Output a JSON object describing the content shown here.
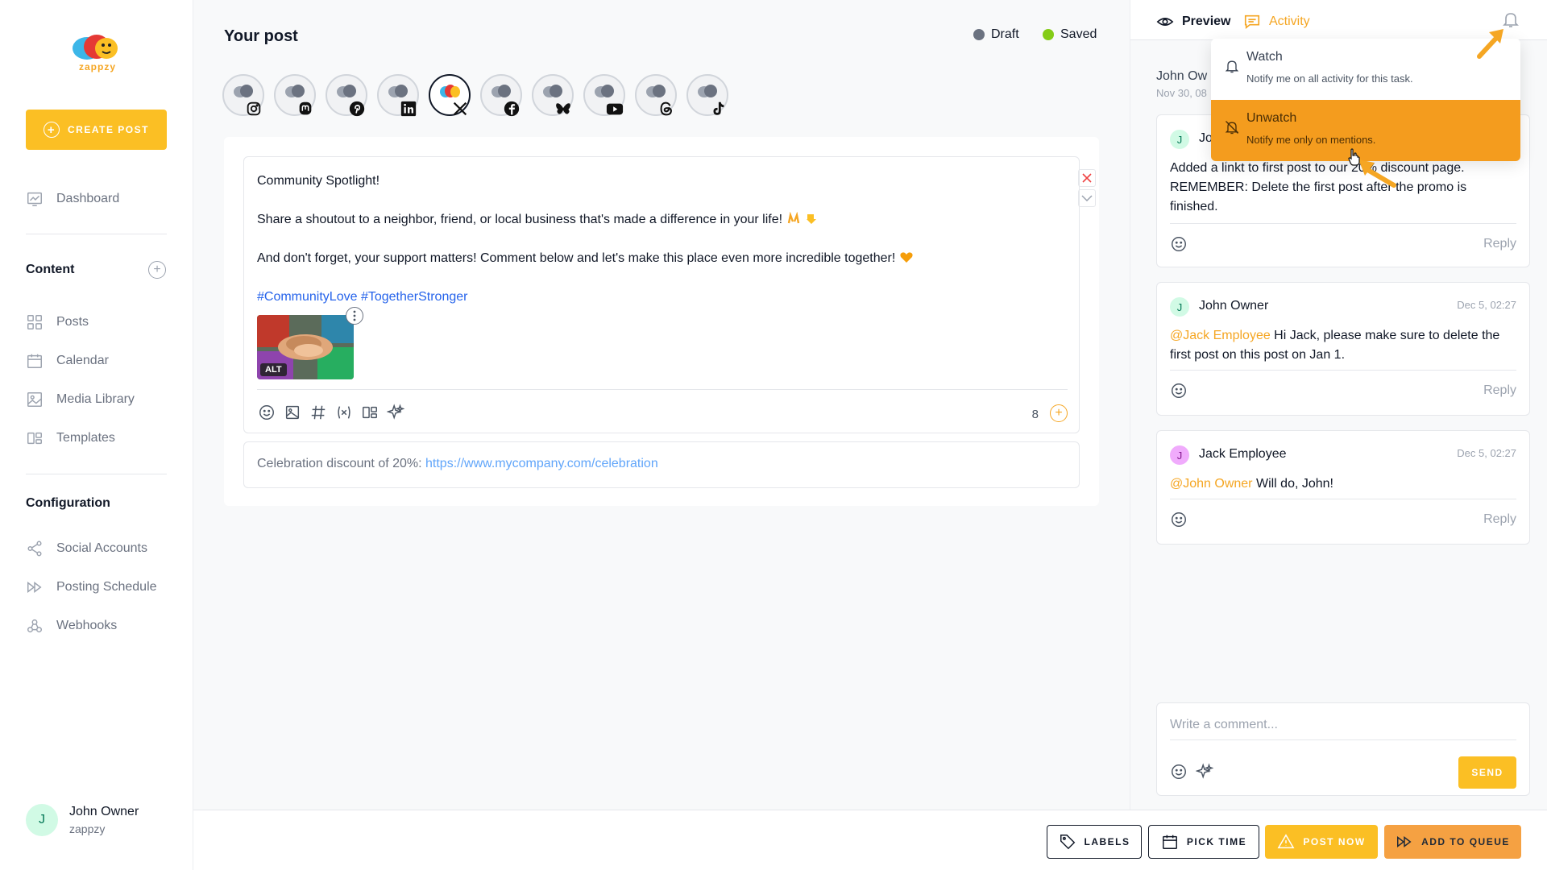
{
  "brand": {
    "name": "zappzy",
    "accent": "#fbbf24"
  },
  "sidebar": {
    "create_label": "CREATE POST",
    "dashboard": "Dashboard",
    "content_title": "Content",
    "content_items": [
      "Posts",
      "Calendar",
      "Media Library",
      "Templates"
    ],
    "config_title": "Configuration",
    "config_items": [
      "Social Accounts",
      "Posting Schedule",
      "Webhooks"
    ],
    "user": {
      "initial": "J",
      "name": "John Owner",
      "org": "zappzy"
    }
  },
  "editor": {
    "title": "Your post",
    "status_draft": "Draft",
    "status_saved": "Saved",
    "channels": [
      "instagram-icon",
      "mastodon-icon",
      "pinterest-icon",
      "linkedin-icon",
      "x-icon",
      "facebook-icon",
      "bluesky-icon",
      "youtube-icon",
      "threads-icon",
      "tiktok-icon"
    ],
    "active_channel": "x-icon",
    "post_lines": {
      "line1": "Community Spotlight!",
      "line2": "Share a shoutout to a neighbor, friend, or local business that's made a difference in your life!",
      "line3": "And don't forget, your support matters! Comment below and let's make this place even more incredible together!",
      "hashtags": "#CommunityLove #TogetherStronger"
    },
    "image_alt_tag": "ALT",
    "char_count": "8",
    "first_comment_prefix": "Celebration discount of 20%: ",
    "first_comment_link": "https://www.mycompany.com/celebration"
  },
  "panel": {
    "tab_preview": "Preview",
    "tab_activity": "Activity",
    "behind_author": "John Ow",
    "behind_date": "Nov 30, 08",
    "comments": [
      {
        "initial": "J",
        "author": "Jo",
        "date": "",
        "mention": "",
        "text": "Added a linkt to first post to our 20% discount page. REMEMBER: Delete the first post after the promo is finished."
      },
      {
        "initial": "J",
        "author": "John Owner",
        "date": "Dec 5, 02:27",
        "mention": "@Jack Employee",
        "text": " Hi Jack, please make sure to delete the first post on this post on Jan 1."
      },
      {
        "initial": "J",
        "author": "Jack Employee",
        "date": "Dec 5, 02:27",
        "mention": "@John Owner",
        "text": " Will do, John!"
      }
    ],
    "reply_label": "Reply",
    "comment_placeholder": "Write a comment...",
    "send_label": "SEND"
  },
  "dropdown": {
    "watch_title": "Watch",
    "watch_desc": "Notify me on all activity for this task.",
    "unwatch_title": "Unwatch",
    "unwatch_desc": "Notify me only on mentions."
  },
  "bottom": {
    "labels": "LABELS",
    "pick_time": "PICK TIME",
    "post_now": "POST NOW",
    "add_queue": "ADD TO QUEUE"
  },
  "colors": {
    "draft": "#6b7280",
    "saved": "#84cc16",
    "activity": "#f5a623",
    "highlight": "#f49c1e",
    "mention": "#f5a623"
  }
}
